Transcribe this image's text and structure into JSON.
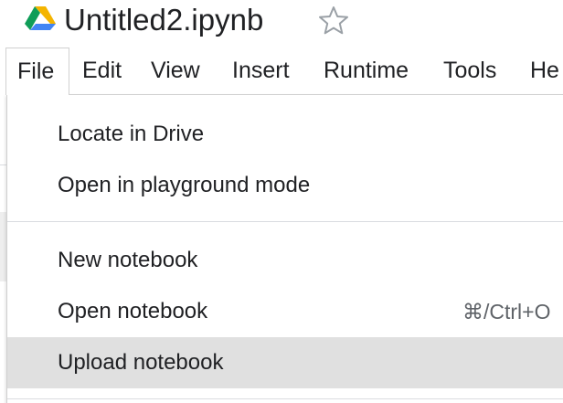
{
  "window": {
    "title": "Untitled2.ipynb",
    "logo_icon": "google-drive-icon",
    "star_icon": "star-outline-icon"
  },
  "menubar": {
    "items": [
      {
        "label": "File",
        "active": true
      },
      {
        "label": "Edit"
      },
      {
        "label": "View"
      },
      {
        "label": "Insert"
      },
      {
        "label": "Runtime"
      },
      {
        "label": "Tools"
      },
      {
        "label": "He"
      }
    ]
  },
  "file_menu": {
    "groups": [
      [
        {
          "label": "Locate in Drive"
        },
        {
          "label": "Open in playground mode"
        }
      ],
      [
        {
          "label": "New notebook"
        },
        {
          "label": "Open notebook",
          "shortcut": "⌘/Ctrl+O"
        },
        {
          "label": "Upload notebook",
          "highlighted": true
        }
      ]
    ]
  },
  "colors": {
    "text": "#202124",
    "hover": "#e0e0e0",
    "divider": "#dadce0",
    "drive_green": "#0F9D58",
    "drive_yellow": "#F4B400",
    "drive_blue": "#4285F4"
  }
}
